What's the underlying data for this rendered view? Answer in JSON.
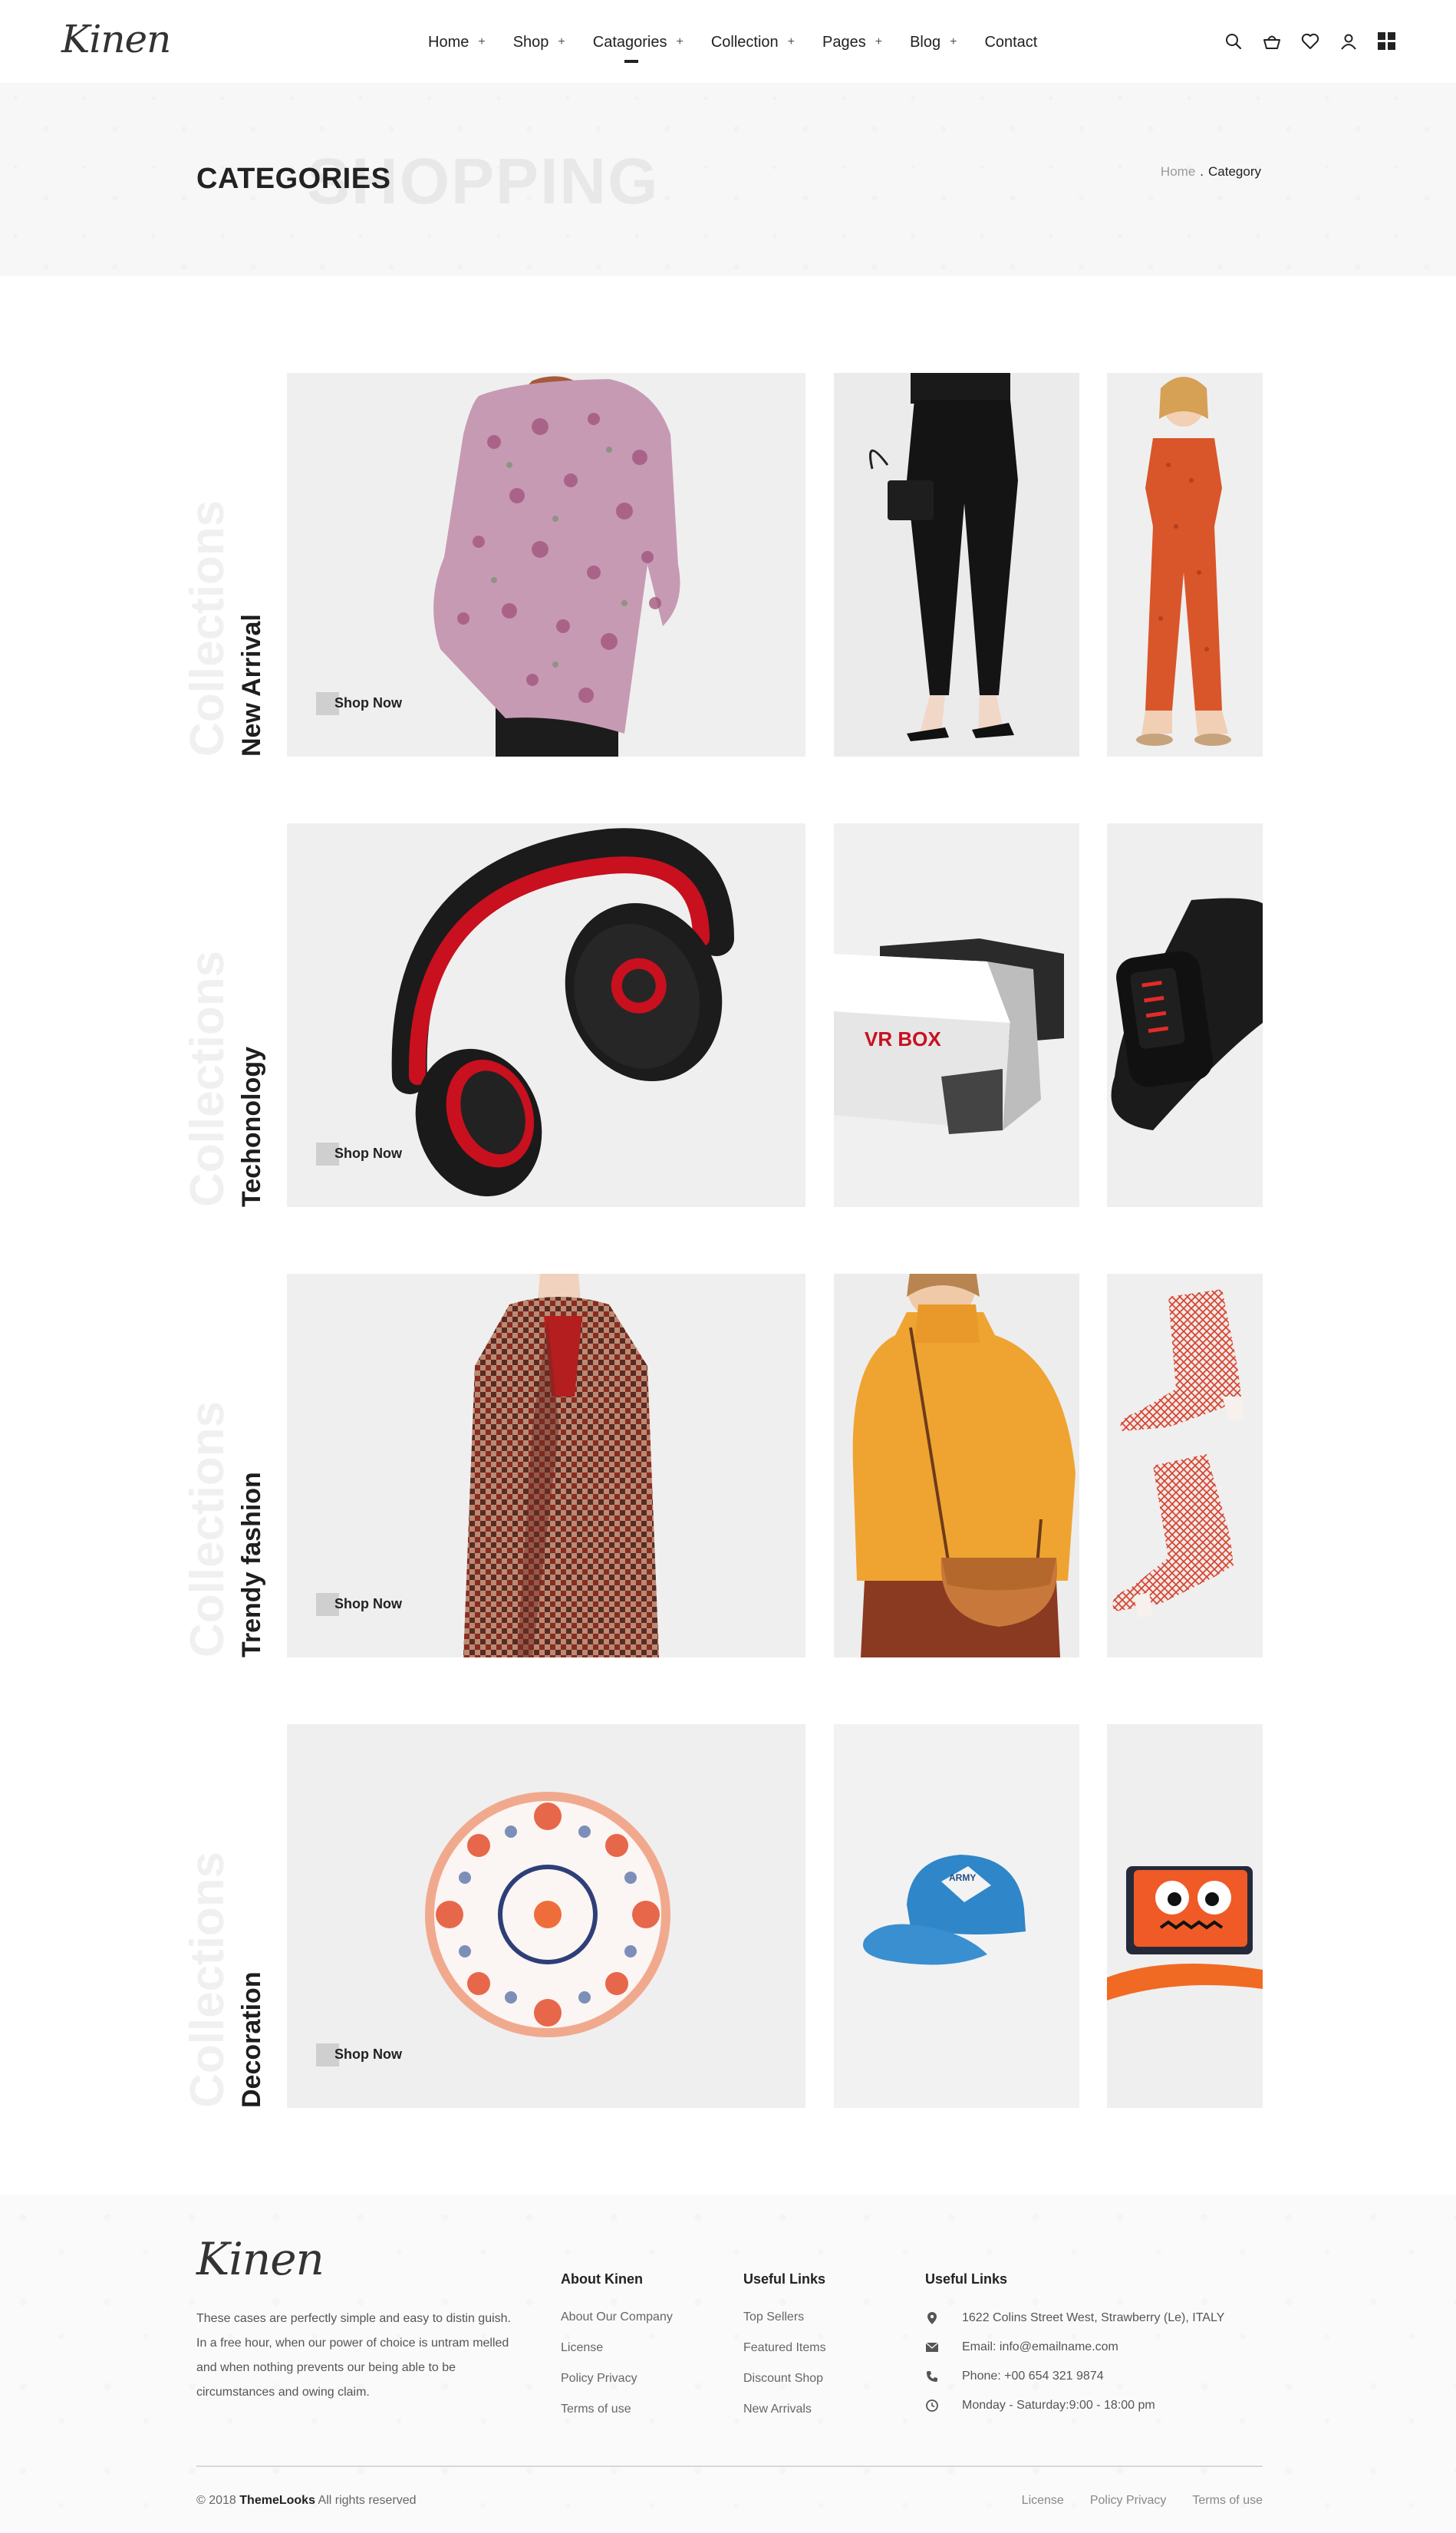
{
  "brand": {
    "logo_text": "Kinen"
  },
  "nav": [
    {
      "label": "Home",
      "plus": "+"
    },
    {
      "label": "Shop",
      "plus": "+"
    },
    {
      "label": "Catagories",
      "plus": "+",
      "active": true
    },
    {
      "label": "Collection",
      "plus": "+"
    },
    {
      "label": "Pages",
      "plus": "+"
    },
    {
      "label": "Blog",
      "plus": "+"
    },
    {
      "label": "Contact",
      "plus": ""
    }
  ],
  "header_icons": [
    "search-icon",
    "basket-icon",
    "heart-icon",
    "user-icon",
    "grid-menu-icon"
  ],
  "banner": {
    "ghost_text": "SHOPPING",
    "title": "CATEGORIES",
    "breadcrumb": {
      "home": "Home",
      "separator": ".",
      "current": "Category"
    }
  },
  "categories": [
    {
      "ghost": "Collections",
      "label": "New Arrival",
      "shop_now": "Shop Now",
      "images": [
        "woman-floral-blouse-photo",
        "woman-black-pants-handbag-photo",
        "girl-orange-jumpsuit-photo"
      ]
    },
    {
      "ghost": "Collections",
      "label": "Techonology",
      "shop_now": "Shop Now",
      "images": [
        "red-black-headphones-photo",
        "vr-box-headset-photo",
        "black-led-watch-photo"
      ]
    },
    {
      "ghost": "Collections",
      "label": "Trendy fashion",
      "shop_now": "Shop Now",
      "images": [
        "woman-houndstooth-coat-photo",
        "woman-yellow-sweater-bag-photo",
        "red-mesh-boots-photo"
      ]
    },
    {
      "ghost": "Collections",
      "label": "Decoration",
      "shop_now": "Shop Now",
      "images": [
        "round-decorative-pillow-photo",
        "blue-army-cap-photo",
        "monster-wallet-photo"
      ]
    }
  ],
  "vr_box_text": "VR BOX",
  "cap_text": "ARMY",
  "footer": {
    "logo_text": "Kinen",
    "about_lines": [
      "These cases are perfectly simple and easy to distin guish.",
      "In a free hour, when our power of choice is untram melled",
      "and when nothing prevents our being able to be",
      "circumstances and owing claim."
    ],
    "col_about": {
      "title": "About Kinen",
      "links": [
        "About Our Company",
        "License",
        "Policy Privacy",
        "Terms of use"
      ]
    },
    "col_useful": {
      "title": "Useful Links",
      "links": [
        "Top Sellers",
        "Featured Items",
        "Discount Shop",
        "New Arrivals"
      ]
    },
    "col_contact": {
      "title": "Useful Links",
      "items": [
        {
          "icon": "map-pin-icon",
          "text": "1622 Colins Street West, Strawberry (Le), ITALY"
        },
        {
          "icon": "envelope-icon",
          "text": "Email: info@emailname.com"
        },
        {
          "icon": "phone-icon",
          "text": "Phone: +00 654 321 9874"
        },
        {
          "icon": "clock-icon",
          "text": "Monday - Saturday:9:00 - 18:00 pm"
        }
      ]
    },
    "copyright_prefix": "© 2018",
    "copyright_brand": "ThemeLooks",
    "copyright_suffix": "All rights reserved",
    "bottom_links": [
      "License",
      "Policy Privacy",
      "Terms of use"
    ]
  },
  "colors": {
    "text_dark": "#222222",
    "banner_bg": "#f7f7f7",
    "tile_bg": "#eeeeee",
    "accent_red": "#d62a2a",
    "accent_orange": "#e8682c"
  }
}
